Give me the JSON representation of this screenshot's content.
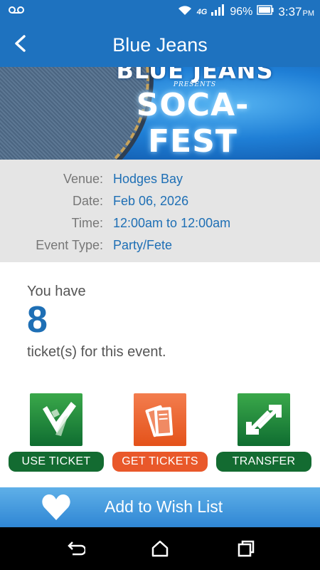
{
  "status_bar": {
    "network": "4G",
    "battery": "96%",
    "time": "3:37",
    "ampm": "PM",
    "icons": [
      "voicemail-icon",
      "wifi-icon",
      "signal-icon",
      "battery-icon"
    ]
  },
  "app_bar": {
    "title": "Blue Jeans",
    "back_icon": "chevron-left-icon"
  },
  "banner": {
    "line1": "BLUE JEANS",
    "line2": "PRESENTS",
    "line3": "SOCA-FEST"
  },
  "details": {
    "venue_label": "Venue:",
    "venue_value": "Hodges Bay",
    "date_label": "Date:",
    "date_value": "Feb 06, 2026",
    "time_label": "Time:",
    "time_value": "12:00am to 12:00am",
    "type_label": "Event Type:",
    "type_value": "Party/Fete"
  },
  "tickets": {
    "prefix": "You have",
    "count": "8",
    "suffix": "ticket(s) for this event."
  },
  "actions": {
    "use_ticket": "USE TICKET",
    "get_tickets": "GET TICKETS",
    "transfer": "TRANSFER"
  },
  "wishlist": {
    "label": "Add to Wish List",
    "icon": "heart-icon"
  },
  "nav": {
    "icons": [
      "back-nav-icon",
      "home-nav-icon",
      "recents-nav-icon"
    ]
  },
  "colors": {
    "primary": "#1e72bf",
    "link": "#1e6fb5",
    "green": "#136b31",
    "orange": "#e9582a",
    "wishlist": "#3a92d8"
  }
}
